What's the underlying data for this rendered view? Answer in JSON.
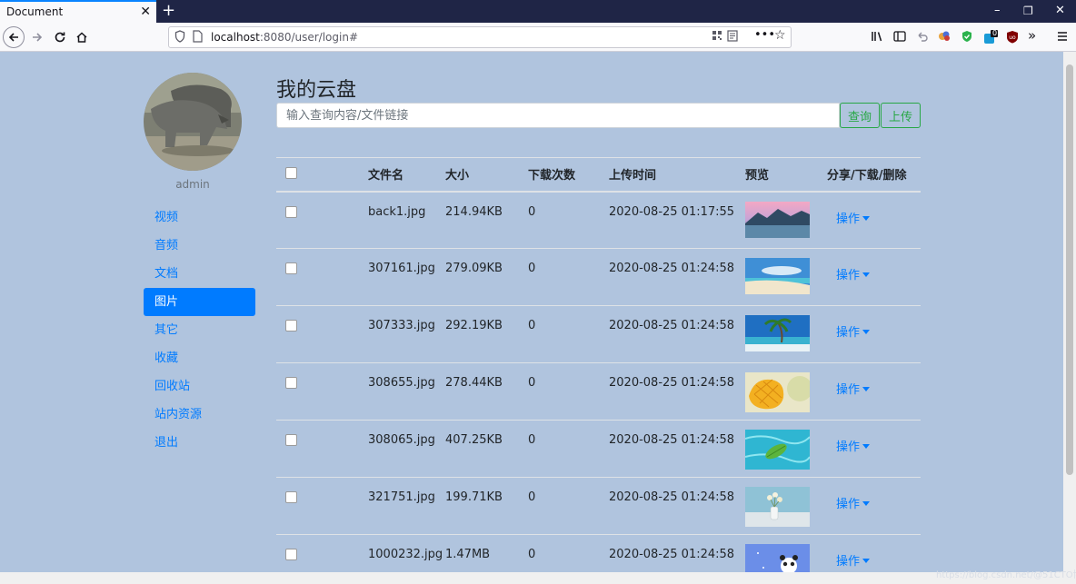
{
  "browser": {
    "tab_title": "Document",
    "tab_close": "✕",
    "new_tab": "+",
    "url_host": "localhost",
    "url_rest": ":8080/user/login#",
    "win_min": "–",
    "win_restore": "❐",
    "win_close": "✕",
    "toolbar_badge": "0"
  },
  "sidebar": {
    "username": "admin",
    "items": [
      {
        "label": "视频",
        "active": false
      },
      {
        "label": "音频",
        "active": false
      },
      {
        "label": "文档",
        "active": false
      },
      {
        "label": "图片",
        "active": true
      },
      {
        "label": "其它",
        "active": false
      },
      {
        "label": "收藏",
        "active": false
      },
      {
        "label": "回收站",
        "active": false
      },
      {
        "label": "站内资源",
        "active": false
      },
      {
        "label": "退出",
        "active": false
      }
    ]
  },
  "main": {
    "title": "我的云盘",
    "search_placeholder": "输入查询内容/文件链接",
    "query_button": "查询",
    "upload_button": "上传"
  },
  "table": {
    "headers": [
      "文件名",
      "大小",
      "下载次数",
      "上传时间",
      "预览",
      "分享/下载/删除"
    ],
    "action_label": "操作",
    "rows": [
      {
        "name": "back1.jpg",
        "size": "214.94KB",
        "downloads": "0",
        "time": "2020-08-25 01:17:55",
        "preview": "mountain-lake"
      },
      {
        "name": "307161.jpg",
        "size": "279.09KB",
        "downloads": "0",
        "time": "2020-08-25 01:24:58",
        "preview": "beach-sky"
      },
      {
        "name": "307333.jpg",
        "size": "292.19KB",
        "downloads": "0",
        "time": "2020-08-25 01:24:58",
        "preview": "palm-beach"
      },
      {
        "name": "308655.jpg",
        "size": "278.44KB",
        "downloads": "0",
        "time": "2020-08-25 01:24:58",
        "preview": "mango"
      },
      {
        "name": "308065.jpg",
        "size": "407.25KB",
        "downloads": "0",
        "time": "2020-08-25 01:24:58",
        "preview": "leaf-water"
      },
      {
        "name": "321751.jpg",
        "size": "199.71KB",
        "downloads": "0",
        "time": "2020-08-25 01:24:58",
        "preview": "flowers-vase"
      },
      {
        "name": "1000232.jpg",
        "size": "1.47MB",
        "downloads": "0",
        "time": "2020-08-25 01:24:58",
        "preview": "cartoon-panda"
      }
    ]
  },
  "watermark": "https://blog.csdn.net/@51CTO博客",
  "colors": {
    "page_bg": "#b0c4de",
    "accent": "#007bff",
    "success": "#28a745"
  }
}
